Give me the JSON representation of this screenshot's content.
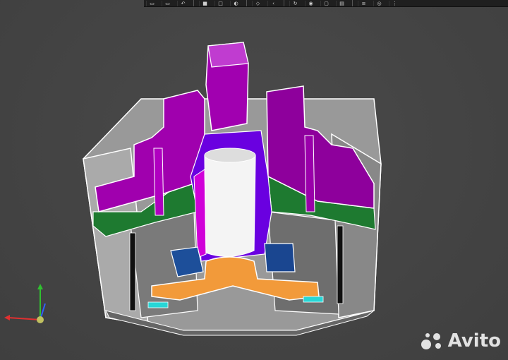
{
  "toolbar": {
    "buttons": [
      {
        "icon": "view-box-icon"
      },
      {
        "icon": "view-box-2-icon"
      },
      {
        "icon": "arrow-left-icon"
      },
      {
        "icon": "cube-icon"
      },
      {
        "icon": "cube-outline-icon"
      },
      {
        "icon": "display-style-icon"
      },
      {
        "icon": "section-view-icon"
      },
      {
        "icon": "chevron-left-icon"
      },
      {
        "icon": "rotate-icon"
      },
      {
        "icon": "camera-icon"
      },
      {
        "icon": "window-icon"
      },
      {
        "icon": "document-icon"
      },
      {
        "icon": "layers-icon"
      },
      {
        "icon": "camera-2-icon"
      },
      {
        "icon": "settings-icon"
      }
    ]
  },
  "watermark": {
    "text": "Avito"
  },
  "colors": {
    "background": "#454545",
    "housing": "#9a9a9a",
    "housing_dark": "#727272",
    "jaw_magenta": "#a200b0",
    "piston_blue": "#6a00e0",
    "green_ring": "#1e7a30",
    "orange_part": "#f29a3a",
    "seal_blue": "#1d4f9a",
    "shaft_white": "#f2f2f2",
    "cyan_seal": "#27d6d6"
  },
  "triad": {
    "x_color": "#e03030",
    "y_color": "#30c030",
    "z_color": "#3060ff"
  }
}
